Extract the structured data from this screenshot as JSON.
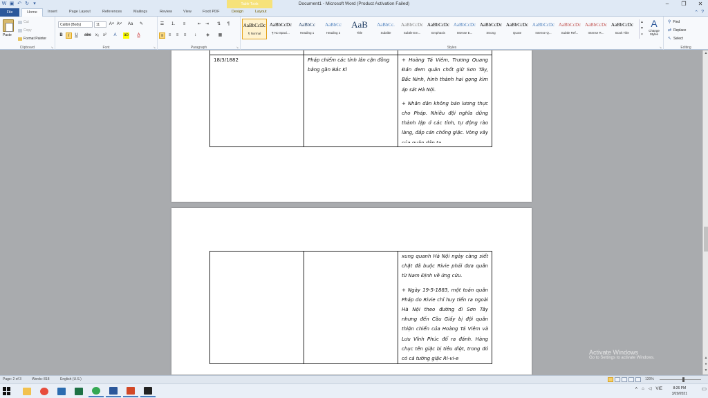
{
  "window": {
    "title": "Document1 - Microsoft Word (Product Activation Failed)",
    "context_group": "Table Tools",
    "controls": [
      "–",
      "❐",
      "✕"
    ]
  },
  "tabs": [
    "File",
    "Home",
    "Insert",
    "Page Layout",
    "References",
    "Mailings",
    "Review",
    "View",
    "Foxit PDF",
    "Design",
    "Layout"
  ],
  "ribbon": {
    "clipboard": {
      "paste": "Paste",
      "cut": "Cut",
      "copy": "Copy",
      "format_painter": "Format Painter",
      "label": "Clipboard"
    },
    "font": {
      "name": "Calibri (Body)",
      "size": "11",
      "label": "Font"
    },
    "paragraph": {
      "label": "Paragraph"
    },
    "styles": {
      "label": "Styles",
      "items": [
        {
          "preview": "AaBbCcDc",
          "name": "¶ Normal",
          "color": "#000000"
        },
        {
          "preview": "AaBbCcDc",
          "name": "¶ No Spaci...",
          "color": "#000000"
        },
        {
          "preview": "AaBbCc",
          "name": "Heading 1",
          "color": "#17365d"
        },
        {
          "preview": "AaBbCc",
          "name": "Heading 2",
          "color": "#4f81bd"
        },
        {
          "preview": "AaB",
          "name": "Title",
          "color": "#17365d"
        },
        {
          "preview": "AaBbCc.",
          "name": "Subtitle",
          "color": "#4f81bd"
        },
        {
          "preview": "AaBbCcDc",
          "name": "Subtle Em...",
          "color": "#808080"
        },
        {
          "preview": "AaBbCcDc",
          "name": "Emphasis",
          "color": "#000000"
        },
        {
          "preview": "AaBbCcDc",
          "name": "Intense E...",
          "color": "#4f81bd"
        },
        {
          "preview": "AaBbCcDc",
          "name": "Strong",
          "color": "#000000"
        },
        {
          "preview": "AaBbCcDc",
          "name": "Quote",
          "color": "#000000"
        },
        {
          "preview": "AaBbCcDc",
          "name": "Intense Q...",
          "color": "#4f81bd"
        },
        {
          "preview": "AaBbCcDc",
          "name": "Subtle Ref...",
          "color": "#c0504d"
        },
        {
          "preview": "AaBbCcDc",
          "name": "Intense R...",
          "color": "#c0504d"
        },
        {
          "preview": "AaBbCcDc",
          "name": "Book Title",
          "color": "#000000"
        }
      ],
      "change_styles": "Change Styles"
    },
    "editing": {
      "find": "Find",
      "replace": "Replace",
      "select": "Select",
      "label": "Editing"
    }
  },
  "page1": {
    "row": {
      "date": "18/3/1882",
      "event": "Pháp chiếm các tỉnh lân cận đồng bằng gần Bắc Kì",
      "para1": "+ Hoàng Tá Viêm, Trương Quang Đản đem quân chốt giữ Sơn Tây, Bắc Ninh, hình thành hai gọng kìm áp sát Hà Nội.",
      "para2": "+ Nhân dân không bán lương thực cho Pháp. Nhiều đội nghĩa dũng thành lập ở các tỉnh, tự động rào làng, đắp cản chống giặc. Vòng vây của quân dân ta"
    }
  },
  "page2": {
    "para1": "xung quanh Hà Nội ngày càng siết chặt đã buộc Rivie phải đưa quân từ Nam Định về ứng cứu.",
    "para2": "+ Ngày 19-5-1883, một toán quân Pháp do Rivie chỉ huy tiến ra ngoài Hà Nội theo đường đi Sơn Tây nhưng đến Cầu Giấy bị đội quân thiện chiến của Hoàng Tá Viêm và Lưu Vĩnh Phúc đổ ra đánh. Hàng chục tên giặc bị tiêu diệt, trong đó có cả tướng giặc Ri-vi-e"
  },
  "watermark": {
    "title": "Activate Windows",
    "subtitle": "Go to Settings to activate Windows."
  },
  "status": {
    "page": "Page: 2 of 3",
    "words": "Words: 818",
    "language": "English (U.S.)",
    "zoom": "120%"
  },
  "taskbar": {
    "apps": [
      {
        "name": "file-explorer",
        "color": "#f2c14e",
        "open": false
      },
      {
        "name": "chrome",
        "color": "#e74c3c",
        "open": false
      },
      {
        "name": "mail",
        "color": "#2b6cb0",
        "open": false
      },
      {
        "name": "excel",
        "color": "#1e7145",
        "open": false
      },
      {
        "name": "chrome",
        "color": "#34a853",
        "open": true
      },
      {
        "name": "word",
        "color": "#2b579a",
        "open": true
      },
      {
        "name": "powerpoint",
        "color": "#d24726",
        "open": true
      },
      {
        "name": "sticky",
        "color": "#222222",
        "open": true
      }
    ],
    "input_lang": "VIE",
    "time": "8:26 PM",
    "date": "3/20/2021"
  }
}
